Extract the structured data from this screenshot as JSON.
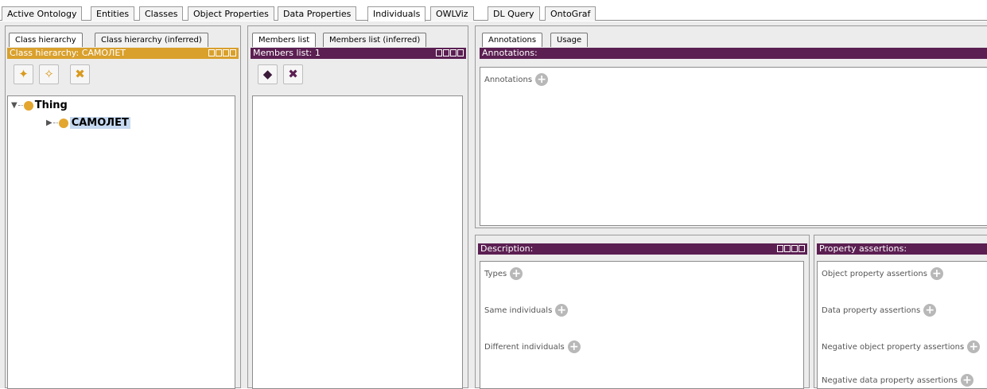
{
  "main_tabs": [
    "Active Ontology",
    "Entities",
    "Classes",
    "Object Properties",
    "Data Properties",
    "Individuals",
    "OWLViz",
    "DL Query",
    "OntoGraf"
  ],
  "main_active_tab": "Individuals",
  "class_panel": {
    "tabs": [
      "Class hierarchy",
      "Class hierarchy (inferred)"
    ],
    "title": "Class hierarchy: САМОЛЕТ",
    "tree": {
      "root": "Thing",
      "child": "САМОЛЕТ"
    },
    "tool_icons": [
      "add-subclass-icon",
      "add-sibling-class-icon",
      "delete-class-icon"
    ]
  },
  "members_panel": {
    "tabs": [
      "Members list",
      "Members list (inferred)"
    ],
    "title": "Members list: 1",
    "tool_icons": [
      "add-individual-icon",
      "delete-individual-icon"
    ]
  },
  "annotations_panel": {
    "tabs": [
      "Annotations",
      "Usage"
    ],
    "title": "Annotations:",
    "label": "Annotations"
  },
  "description_panel": {
    "title": "Description:",
    "labels": [
      "Types",
      "Same individuals",
      "Different individuals"
    ]
  },
  "property_panel": {
    "title": "Property assertions:",
    "labels": [
      "Object property assertions",
      "Data property assertions",
      "Negative object property assertions",
      "Negative data property assertions"
    ]
  },
  "colors": {
    "class_title": "#d9a02c",
    "view_title": "#5b1f52",
    "class_dot": "#e3a62f",
    "selection": "#c6d9f1"
  }
}
